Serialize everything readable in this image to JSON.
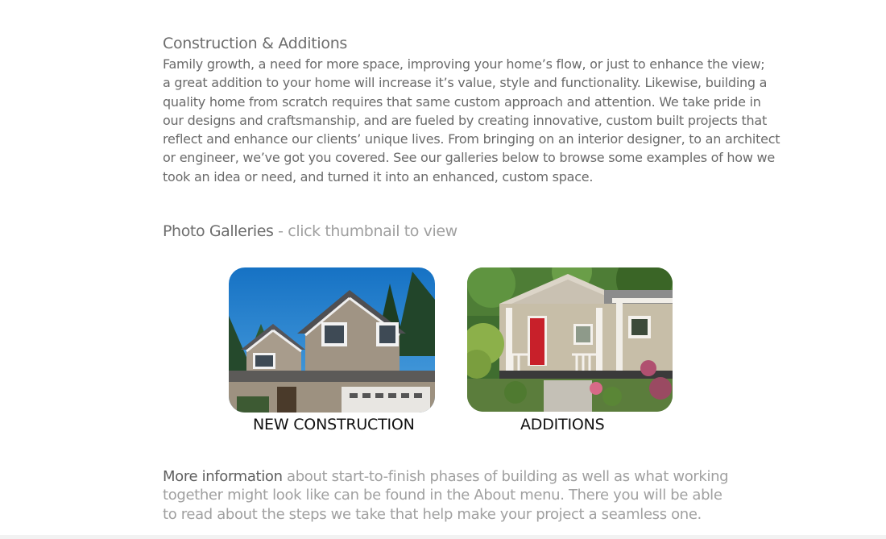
{
  "construction": {
    "title": "Construction & Additions",
    "intro_lines": [
      "Family growth, a need for more space, improving your home’s flow, or just to enhance the view;",
      "a great addition to your home will increase it’s value, style and functionality.  Likewise, building a",
      "quality home from scratch requires that same custom approach and attention.  We take pride in",
      "our designs and craftsmanship, and are fueled by creating innovative, custom built projects that",
      "reflect and enhance our clients’ unique lives.  From bringing on an interior designer, to an architect",
      "or engineer, we’ve got you covered.  See our galleries below to browse some examples of how we",
      "took an idea or need, and turned it into an enhanced, custom space."
    ]
  },
  "galleries": {
    "heading": "Photo Galleries",
    "hint": " - click thumbnail to view",
    "items": [
      {
        "label": "NEW CONSTRUCTION",
        "icon": "house-photo"
      },
      {
        "label": "ADDITIONS",
        "icon": "porch-photo"
      }
    ]
  },
  "more_info": {
    "lead": "More information",
    "lines": [
      " about start-to-finish phases of building as well as what working",
      "together might look like can be found in the About menu.  There you will be able",
      "to read about the steps we take that help make your project a seamless one."
    ]
  },
  "colors": {
    "text": "#6a6a6a",
    "muted": "#a0a0a0",
    "caption": "#111111"
  }
}
